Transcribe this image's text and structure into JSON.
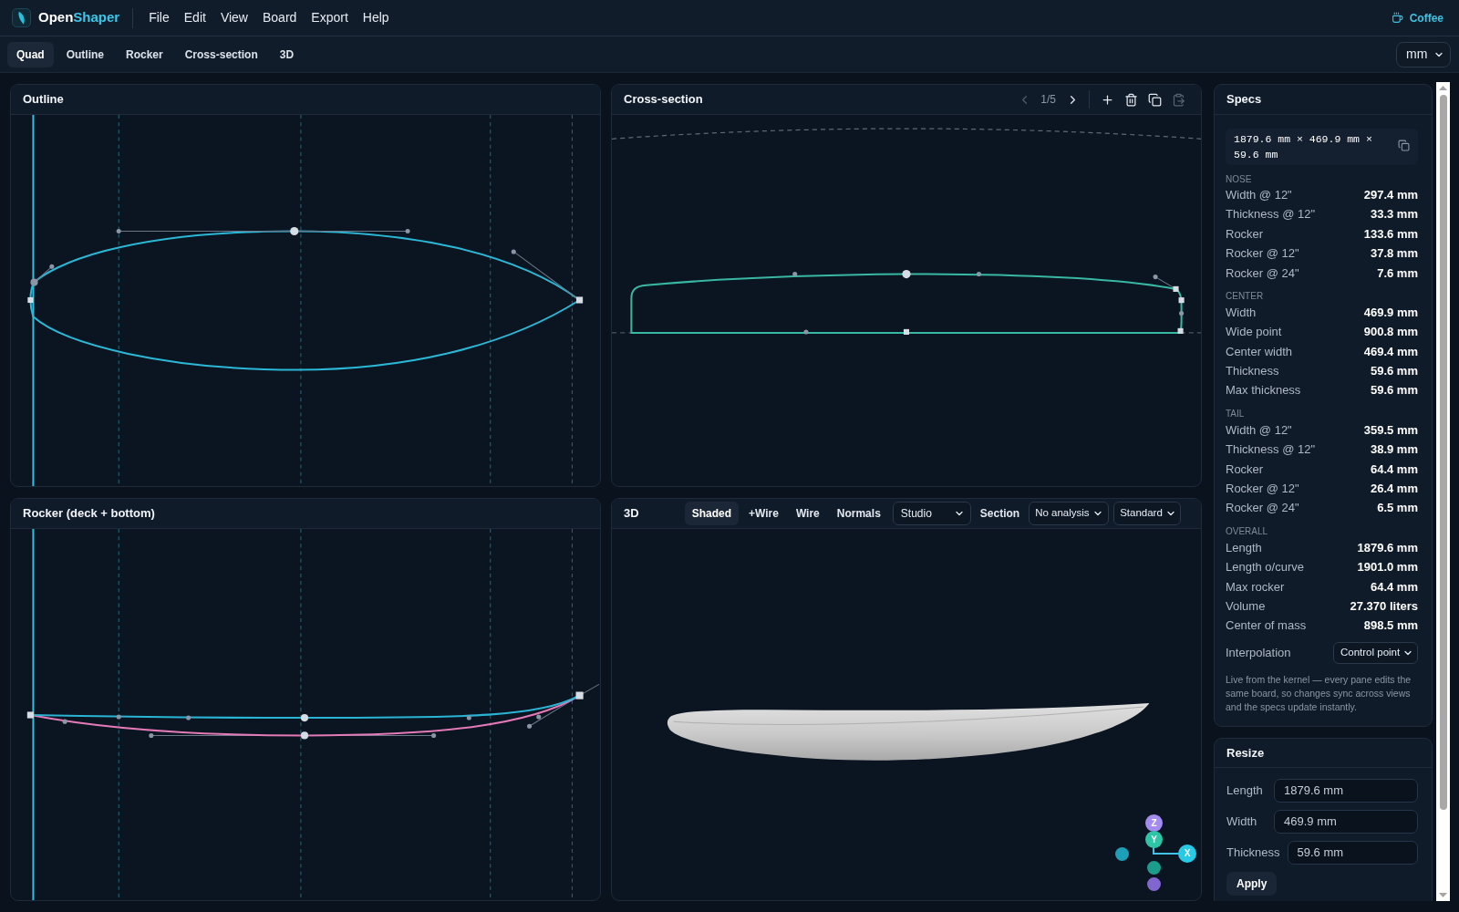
{
  "top_bar": {
    "brand": {
      "part_1": "Open",
      "part_2": "Shaper"
    },
    "menu": [
      "File",
      "Edit",
      "View",
      "Board",
      "Export",
      "Help"
    ],
    "coffee_link": "Coffee"
  },
  "view_tabs": [
    {
      "label": "Quad",
      "selected": true
    },
    {
      "label": "Outline",
      "selected": false
    },
    {
      "label": "Rocker",
      "selected": false
    },
    {
      "label": "Cross-section",
      "selected": false
    },
    {
      "label": "3D",
      "selected": false
    }
  ],
  "units_select": {
    "value": "mm"
  },
  "outline_pane": {
    "title": "Outline"
  },
  "cross_section_pane": {
    "title": "Cross-section",
    "pager": {
      "text": "1/5",
      "previous_disabled": true,
      "next_disabled": false
    },
    "actions": [
      {
        "kind": "add",
        "disabled": false
      },
      {
        "kind": "delete",
        "disabled": false
      },
      {
        "kind": "duplicate",
        "disabled": false
      },
      {
        "kind": "paste",
        "disabled": true
      }
    ]
  },
  "rocker_pane": {
    "title": "Rocker (deck + bottom)"
  },
  "view_3d_pane": {
    "title": "3D",
    "modes": [
      {
        "label": "Shaded",
        "selected": true
      },
      {
        "label": "+Wire",
        "selected": false
      },
      {
        "label": "Wire",
        "selected": false
      },
      {
        "label": "Normals",
        "selected": false
      }
    ],
    "environment_select": {
      "value": "Studio"
    },
    "section_button": "Section",
    "analysis_select": {
      "value": "No analysis"
    },
    "camera_select": {
      "value": "Standard"
    },
    "axis_gizmo": {
      "axes": [
        {
          "label": "Z",
          "color": "#a48bf0"
        },
        {
          "label": "Y",
          "color": "#2ec4a6"
        },
        {
          "label": "X",
          "color": "#27c9e6"
        }
      ],
      "negative_axes": [
        {
          "color": "#1d9fb7"
        },
        {
          "color": "#1c9c8a"
        },
        {
          "color": "#8266cf"
        }
      ]
    }
  },
  "specs": {
    "title": "Specs",
    "dimensions": "1879.6 mm × 469.9 mm × 59.6 mm",
    "groups": [
      {
        "heading": "NOSE",
        "rows": [
          {
            "label": "Width @ 12\"",
            "value": "297.4 mm"
          },
          {
            "label": "Thickness @ 12\"",
            "value": "33.3 mm"
          },
          {
            "label": "Rocker",
            "value": "133.6 mm"
          },
          {
            "label": "Rocker @ 12\"",
            "value": "37.8 mm"
          },
          {
            "label": "Rocker @ 24\"",
            "value": "7.6 mm"
          }
        ]
      },
      {
        "heading": "CENTER",
        "rows": [
          {
            "label": "Width",
            "value": "469.9 mm"
          },
          {
            "label": "Wide point",
            "value": "900.8 mm"
          },
          {
            "label": "Center width",
            "value": "469.4 mm"
          },
          {
            "label": "Thickness",
            "value": "59.6 mm"
          },
          {
            "label": "Max thickness",
            "value": "59.6 mm"
          }
        ]
      },
      {
        "heading": "TAIL",
        "rows": [
          {
            "label": "Width @ 12\"",
            "value": "359.5 mm"
          },
          {
            "label": "Thickness @ 12\"",
            "value": "38.9 mm"
          },
          {
            "label": "Rocker",
            "value": "64.4 mm"
          },
          {
            "label": "Rocker @ 12\"",
            "value": "26.4 mm"
          },
          {
            "label": "Rocker @ 24\"",
            "value": "6.5 mm"
          }
        ]
      },
      {
        "heading": "OVERALL",
        "rows": [
          {
            "label": "Length",
            "value": "1879.6 mm"
          },
          {
            "label": "Length o/curve",
            "value": "1901.0 mm"
          },
          {
            "label": "Max rocker",
            "value": "64.4 mm"
          },
          {
            "label": "Volume",
            "value": "27.370 liters"
          },
          {
            "label": "Center of mass",
            "value": "898.5 mm"
          }
        ]
      }
    ],
    "interpolation": {
      "label": "Interpolation",
      "value": "Control point"
    },
    "note": "Live from the kernel — every pane edits the same board, so changes sync across views and the specs update instantly."
  },
  "resize": {
    "title": "Resize",
    "fields": [
      {
        "label": "Length",
        "value": "1879.6 mm"
      },
      {
        "label": "Width",
        "value": "469.9 mm"
      },
      {
        "label": "Thickness",
        "value": "59.6 mm"
      }
    ],
    "apply_button": "Apply"
  }
}
